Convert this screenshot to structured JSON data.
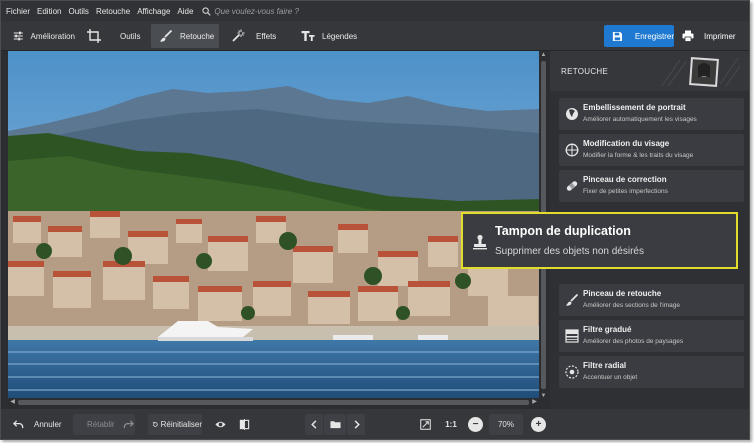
{
  "menu": [
    "Fichier",
    "Edition",
    "Outils",
    "Retouche",
    "Affichage",
    "Aide"
  ],
  "search": {
    "placeholder": "Que voulez-vous faire ?"
  },
  "tabs": [
    {
      "label": "Amélioration",
      "icon": "sliders-icon"
    },
    {
      "label": "Outils",
      "icon": "crop-icon"
    },
    {
      "label": "Retouche",
      "icon": "brush-icon",
      "active": true
    },
    {
      "label": "Effets",
      "icon": "magic-wand-icon"
    },
    {
      "label": "Légendes",
      "icon": "text-icon"
    }
  ],
  "actions": {
    "save": "Enregistrer",
    "print": "Imprimer"
  },
  "panel": {
    "title": "RETOUCHE",
    "items": [
      {
        "title": "Embellissement de portrait",
        "desc": "Améliorer automatiquement les visages",
        "icon": "face-icon"
      },
      {
        "title": "Modification du visage",
        "desc": "Modifier la forme & les traits du visage",
        "icon": "face-outline-icon"
      },
      {
        "title": "Pinceau de correction",
        "desc": "Fixer de petites imperfections",
        "icon": "bandage-icon"
      },
      {
        "title": "Pinceau de retouche",
        "desc": "Améliorer des sections de l'image",
        "icon": "brush-icon"
      },
      {
        "title": "Filtre gradué",
        "desc": "Améliorer des photos de paysages",
        "icon": "gradient-icon"
      },
      {
        "title": "Filtre radial",
        "desc": "Accentuer un objet",
        "icon": "radial-icon"
      }
    ]
  },
  "highlight": {
    "title": "Tampon de duplication",
    "desc": "Supprimer des objets non désirés",
    "icon": "stamp-icon",
    "border_color": "#e2dd2a"
  },
  "bottom": {
    "undo": "Annuler",
    "redo": "Rétablir",
    "reset": "Réinitialiser",
    "ratio": "1:1",
    "zoom": "70%"
  },
  "colors": {
    "accent": "#1f79d0",
    "bg": "#2b2d30",
    "toolbar": "#35373b"
  }
}
